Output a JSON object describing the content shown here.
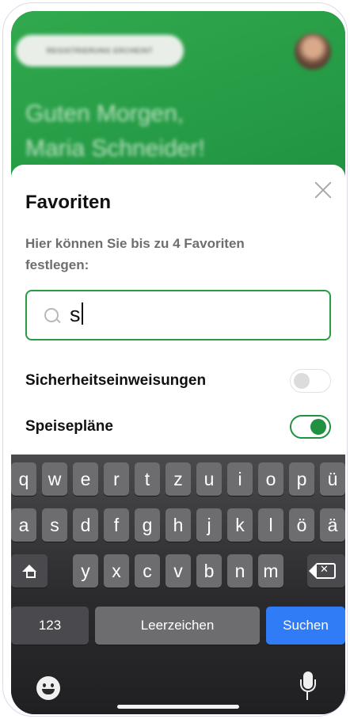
{
  "header": {
    "pill_label": "REGISTRIERUNG ERCHEINT",
    "greeting_line1": "Guten Morgen,",
    "greeting_line2": "Maria Schneider!"
  },
  "sheet": {
    "title": "Favoriten",
    "subtitle": "Hier können Sie bis zu 4 Favoriten festlegen:",
    "search": {
      "value": "s"
    },
    "items": [
      {
        "label": "Sicherheitseinweisungen",
        "enabled": false
      },
      {
        "label": "Speisepläne",
        "enabled": true
      }
    ]
  },
  "keyboard": {
    "row1": [
      "q",
      "w",
      "e",
      "r",
      "t",
      "z",
      "u",
      "i",
      "o",
      "p",
      "ü"
    ],
    "row2": [
      "a",
      "s",
      "d",
      "f",
      "g",
      "h",
      "j",
      "k",
      "l",
      "ö",
      "ä"
    ],
    "row3": [
      "y",
      "x",
      "c",
      "v",
      "b",
      "n",
      "m"
    ],
    "numbers_label": "123",
    "space_label": "Leerzeichen",
    "action_label": "Suchen"
  },
  "colors": {
    "brand_green": "#1f9140",
    "action_blue": "#2f7cf6"
  }
}
